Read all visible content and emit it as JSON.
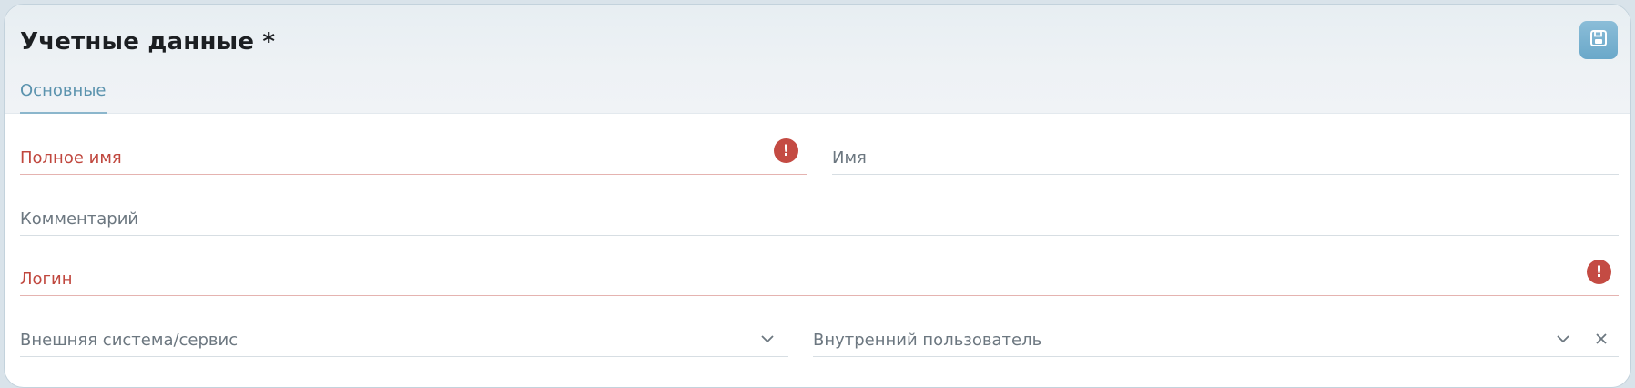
{
  "form": {
    "title": "Учетные данные *",
    "tabs": [
      {
        "label": "Основные",
        "active": true
      }
    ],
    "fields": {
      "full_name": {
        "label": "Полное имя",
        "value": "",
        "error": true
      },
      "name": {
        "label": "Имя",
        "value": ""
      },
      "comment": {
        "label": "Комментарий",
        "value": ""
      },
      "login": {
        "label": "Логин",
        "value": "",
        "error": true
      },
      "external_system": {
        "label": "Внешняя система/сервис",
        "value": ""
      },
      "internal_user": {
        "label": "Внутренний пользователь",
        "value": ""
      }
    },
    "icons": {
      "save": "floppy-disk-icon",
      "error": "exclamation-icon",
      "dropdown": "chevron-down-icon",
      "clear": "close-icon"
    }
  },
  "colors": {
    "accent": "#5b93ae",
    "error": "#c44b43",
    "title": "#1c1f22"
  }
}
